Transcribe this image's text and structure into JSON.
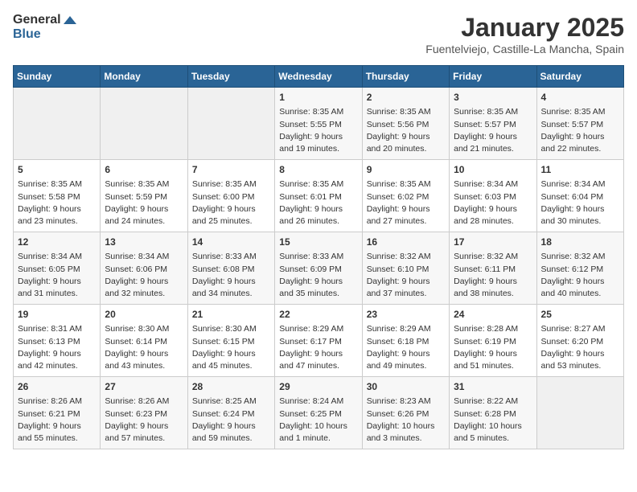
{
  "logo": {
    "general": "General",
    "blue": "Blue"
  },
  "header": {
    "title": "January 2025",
    "subtitle": "Fuentelviejo, Castille-La Mancha, Spain"
  },
  "weekdays": [
    "Sunday",
    "Monday",
    "Tuesday",
    "Wednesday",
    "Thursday",
    "Friday",
    "Saturday"
  ],
  "weeks": [
    [
      {
        "day": "",
        "info": ""
      },
      {
        "day": "",
        "info": ""
      },
      {
        "day": "",
        "info": ""
      },
      {
        "day": "1",
        "info": "Sunrise: 8:35 AM\nSunset: 5:55 PM\nDaylight: 9 hours and 19 minutes."
      },
      {
        "day": "2",
        "info": "Sunrise: 8:35 AM\nSunset: 5:56 PM\nDaylight: 9 hours and 20 minutes."
      },
      {
        "day": "3",
        "info": "Sunrise: 8:35 AM\nSunset: 5:57 PM\nDaylight: 9 hours and 21 minutes."
      },
      {
        "day": "4",
        "info": "Sunrise: 8:35 AM\nSunset: 5:57 PM\nDaylight: 9 hours and 22 minutes."
      }
    ],
    [
      {
        "day": "5",
        "info": "Sunrise: 8:35 AM\nSunset: 5:58 PM\nDaylight: 9 hours and 23 minutes."
      },
      {
        "day": "6",
        "info": "Sunrise: 8:35 AM\nSunset: 5:59 PM\nDaylight: 9 hours and 24 minutes."
      },
      {
        "day": "7",
        "info": "Sunrise: 8:35 AM\nSunset: 6:00 PM\nDaylight: 9 hours and 25 minutes."
      },
      {
        "day": "8",
        "info": "Sunrise: 8:35 AM\nSunset: 6:01 PM\nDaylight: 9 hours and 26 minutes."
      },
      {
        "day": "9",
        "info": "Sunrise: 8:35 AM\nSunset: 6:02 PM\nDaylight: 9 hours and 27 minutes."
      },
      {
        "day": "10",
        "info": "Sunrise: 8:34 AM\nSunset: 6:03 PM\nDaylight: 9 hours and 28 minutes."
      },
      {
        "day": "11",
        "info": "Sunrise: 8:34 AM\nSunset: 6:04 PM\nDaylight: 9 hours and 30 minutes."
      }
    ],
    [
      {
        "day": "12",
        "info": "Sunrise: 8:34 AM\nSunset: 6:05 PM\nDaylight: 9 hours and 31 minutes."
      },
      {
        "day": "13",
        "info": "Sunrise: 8:34 AM\nSunset: 6:06 PM\nDaylight: 9 hours and 32 minutes."
      },
      {
        "day": "14",
        "info": "Sunrise: 8:33 AM\nSunset: 6:08 PM\nDaylight: 9 hours and 34 minutes."
      },
      {
        "day": "15",
        "info": "Sunrise: 8:33 AM\nSunset: 6:09 PM\nDaylight: 9 hours and 35 minutes."
      },
      {
        "day": "16",
        "info": "Sunrise: 8:32 AM\nSunset: 6:10 PM\nDaylight: 9 hours and 37 minutes."
      },
      {
        "day": "17",
        "info": "Sunrise: 8:32 AM\nSunset: 6:11 PM\nDaylight: 9 hours and 38 minutes."
      },
      {
        "day": "18",
        "info": "Sunrise: 8:32 AM\nSunset: 6:12 PM\nDaylight: 9 hours and 40 minutes."
      }
    ],
    [
      {
        "day": "19",
        "info": "Sunrise: 8:31 AM\nSunset: 6:13 PM\nDaylight: 9 hours and 42 minutes."
      },
      {
        "day": "20",
        "info": "Sunrise: 8:30 AM\nSunset: 6:14 PM\nDaylight: 9 hours and 43 minutes."
      },
      {
        "day": "21",
        "info": "Sunrise: 8:30 AM\nSunset: 6:15 PM\nDaylight: 9 hours and 45 minutes."
      },
      {
        "day": "22",
        "info": "Sunrise: 8:29 AM\nSunset: 6:17 PM\nDaylight: 9 hours and 47 minutes."
      },
      {
        "day": "23",
        "info": "Sunrise: 8:29 AM\nSunset: 6:18 PM\nDaylight: 9 hours and 49 minutes."
      },
      {
        "day": "24",
        "info": "Sunrise: 8:28 AM\nSunset: 6:19 PM\nDaylight: 9 hours and 51 minutes."
      },
      {
        "day": "25",
        "info": "Sunrise: 8:27 AM\nSunset: 6:20 PM\nDaylight: 9 hours and 53 minutes."
      }
    ],
    [
      {
        "day": "26",
        "info": "Sunrise: 8:26 AM\nSunset: 6:21 PM\nDaylight: 9 hours and 55 minutes."
      },
      {
        "day": "27",
        "info": "Sunrise: 8:26 AM\nSunset: 6:23 PM\nDaylight: 9 hours and 57 minutes."
      },
      {
        "day": "28",
        "info": "Sunrise: 8:25 AM\nSunset: 6:24 PM\nDaylight: 9 hours and 59 minutes."
      },
      {
        "day": "29",
        "info": "Sunrise: 8:24 AM\nSunset: 6:25 PM\nDaylight: 10 hours and 1 minute."
      },
      {
        "day": "30",
        "info": "Sunrise: 8:23 AM\nSunset: 6:26 PM\nDaylight: 10 hours and 3 minutes."
      },
      {
        "day": "31",
        "info": "Sunrise: 8:22 AM\nSunset: 6:28 PM\nDaylight: 10 hours and 5 minutes."
      },
      {
        "day": "",
        "info": ""
      }
    ]
  ]
}
